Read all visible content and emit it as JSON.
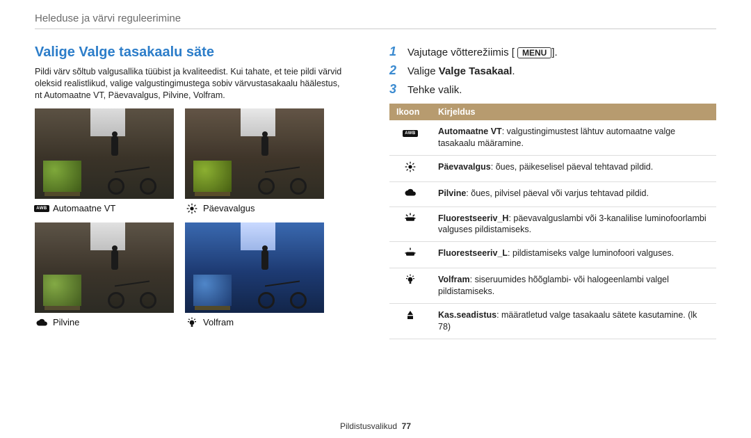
{
  "breadcrumb": "Heleduse ja värvi reguleerimine",
  "title": "Valige Valge tasakaalu säte",
  "intro": "Pildi värv sõltub valgusallika tüübist ja kvaliteedist. Kui tahate, et teie pildi värvid oleksid realistlikud, valige valgustingimustega sobiv värvustasakaalu häälestus, nt Automaatne VT, Päevavalgus, Pilvine, Volfram.",
  "thumbs": [
    {
      "icon": "awb",
      "label": "Automaatne VT"
    },
    {
      "icon": "sun",
      "label": "Päevavalgus"
    },
    {
      "icon": "cloud",
      "label": "Pilvine"
    },
    {
      "icon": "bulb",
      "label": "Volfram"
    }
  ],
  "steps": [
    {
      "num": "1",
      "text_a": "Vajutage võtterežiimis [",
      "menu": "MENU",
      "text_b": "]."
    },
    {
      "num": "2",
      "text_a": "Valige ",
      "bold": "Valge Tasakaal",
      "text_b": "."
    },
    {
      "num": "3",
      "text_a": "Tehke valik.",
      "text_b": ""
    }
  ],
  "table": {
    "headers": [
      "Ikoon",
      "Kirjeldus"
    ],
    "rows": [
      {
        "icon": "awb",
        "term": "Automaatne VT",
        "desc": ": valgustingimustest lähtuv automaatne valge tasakaalu määramine."
      },
      {
        "icon": "sun",
        "term": "Päevavalgus",
        "desc": ": õues, päikeselisel päeval tehtavad pildid."
      },
      {
        "icon": "cloud",
        "term": "Pilvine",
        "desc": ": õues, pilvisel päeval või varjus tehtavad pildid."
      },
      {
        "icon": "fluorH",
        "term": "Fluorestseeriv_H",
        "desc": ": päevavalguslambi või 3-kanalilise luminofoorlambi valguses pildistamiseks."
      },
      {
        "icon": "fluorL",
        "term": "Fluorestseeriv_L",
        "desc": ": pildistamiseks valge luminofoori valguses."
      },
      {
        "icon": "bulb",
        "term": "Volfram",
        "desc": ": siseruumides hõõglambi- või halogeenlambi valgel pildistamiseks."
      },
      {
        "icon": "custom",
        "term": "Kas.seadistus",
        "desc": ": määratletud  valge tasakaalu sätete kasutamine. (lk 78)"
      }
    ]
  },
  "footer": {
    "label": "Pildistusvalikud",
    "page": "77"
  }
}
